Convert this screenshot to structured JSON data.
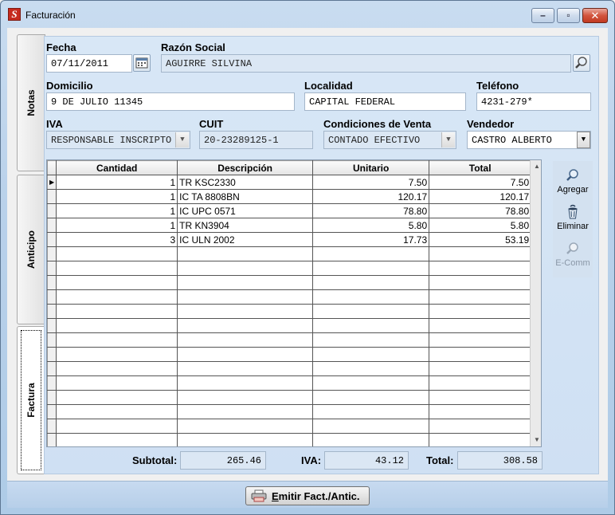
{
  "window": {
    "title": "Facturación",
    "app_icon": "app-logo-icon"
  },
  "tabs": [
    {
      "label": "Notas",
      "active": false
    },
    {
      "label": "Anticipo",
      "active": false
    },
    {
      "label": "Factura",
      "active": true
    }
  ],
  "form": {
    "fecha": {
      "label": "Fecha",
      "value": "07/11/2011"
    },
    "razon_social": {
      "label": "Razón Social",
      "value": "AGUIRRE SILVINA"
    },
    "domicilio": {
      "label": "Domicilio",
      "value": "9 DE JULIO 11345"
    },
    "localidad": {
      "label": "Localidad",
      "value": "CAPITAL FEDERAL"
    },
    "telefono": {
      "label": "Teléfono",
      "value": "4231-279*"
    },
    "iva": {
      "label": "IVA",
      "value": "RESPONSABLE INSCRIPTO"
    },
    "cuit": {
      "label": "CUIT",
      "value": "20-23289125-1"
    },
    "condiciones": {
      "label": "Condiciones de Venta",
      "value": "CONTADO EFECTIVO"
    },
    "vendedor": {
      "label": "Vendedor",
      "value": "CASTRO ALBERTO"
    }
  },
  "grid": {
    "headers": [
      "Cantidad",
      "Descripción",
      "Unitario",
      "Total"
    ],
    "rows": [
      [
        "1",
        "TR KSC2330",
        "7.50",
        "7.50"
      ],
      [
        "1",
        "IC TA 8808BN",
        "120.17",
        "120.17"
      ],
      [
        "1",
        "IC UPC 0571",
        "78.80",
        "78.80"
      ],
      [
        "1",
        "TR KN3904",
        "5.80",
        "5.80"
      ],
      [
        "3",
        "IC ULN 2002",
        "17.73",
        "53.19"
      ]
    ],
    "empty_rows": 14
  },
  "actions": [
    {
      "label": "Agregar",
      "icon": "magnifier-icon",
      "enabled": true
    },
    {
      "label": "Eliminar",
      "icon": "recycle-bin-icon",
      "enabled": true
    },
    {
      "label": "E-Comm",
      "icon": "magnifier-icon",
      "enabled": false
    }
  ],
  "totals": {
    "subtotal_label": "Subtotal:",
    "subtotal": "265.46",
    "iva_label": "IVA:",
    "iva": "43.12",
    "total_label": "Total:",
    "total": "308.58"
  },
  "emit_button": {
    "label_prefix": "",
    "accel": "E",
    "label_rest": "mitir Fact./Antic.",
    "icon": "printer-icon"
  },
  "colors": {
    "panel": "#d3e2f3",
    "chrome": "#b9d1ea",
    "close": "#c13a22"
  }
}
